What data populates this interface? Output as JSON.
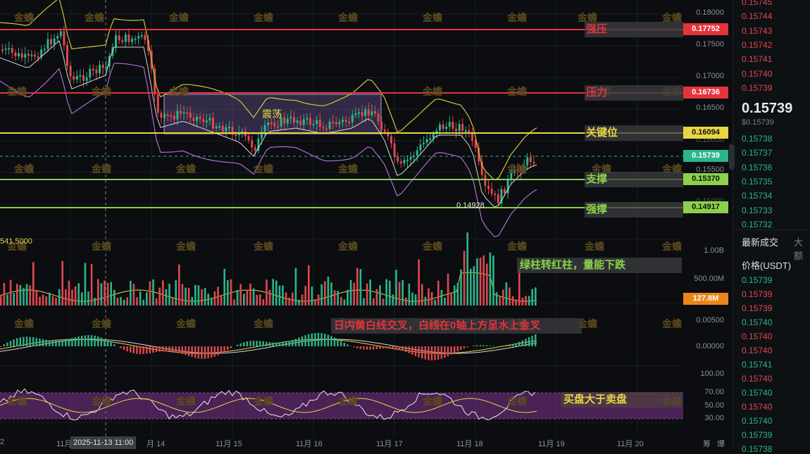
{
  "colors": {
    "up": "#2bb58a",
    "down": "#e0484f",
    "yellow": "#e8d641",
    "green": "#8bd14a",
    "red": "#e3343c",
    "purple": "#b06ad0",
    "white": "#d8d8d8"
  },
  "price_axis": [
    "0.18000",
    "0.17500",
    "0.17000",
    "0.16500",
    "0.16000",
    "0.15500",
    "0.15000"
  ],
  "price_tags": {
    "p17752": "0.17752",
    "p16736": "0.16736",
    "p16094": "0.16094",
    "p15739": "0.15739",
    "p15370": "0.15370",
    "p14917": "0.14917"
  },
  "levels": {
    "strong_resist": "强压",
    "resist": "压力",
    "key": "关键位",
    "support": "支撑",
    "strong_support": "强撑"
  },
  "range_label": "震荡",
  "low_label": "0.14928",
  "volume": {
    "left_value": "541.5000",
    "axis_1b": "1.00B",
    "axis_500m": "500.00M",
    "current": "127.8M",
    "note": "绿柱转红柱，量能下跌"
  },
  "macd": {
    "axis_top": "0.00500",
    "axis_zero": "0.00000",
    "note": "日内黄白线交叉，白线在0轴上方呈水上金叉"
  },
  "rsi": {
    "axis_100": "100.00",
    "axis_70": "70.00",
    "axis_50": "50.00",
    "axis_30": "30.00",
    "note": "买盘大于卖盘"
  },
  "time_axis": {
    "l0": "2",
    "l1": "11月",
    "crosshair": "2025-11-13 11:00",
    "l2": "月 14",
    "l3": "11月 15",
    "l4": "11月 16",
    "l5": "11月 17",
    "l6": "11月 18",
    "l7": "11月 19",
    "l8": "11月 20",
    "corner1": "筹",
    "corner2": "爆"
  },
  "watermark": "金蟾",
  "order_book": {
    "asks": [
      "0.15745",
      "0.15744",
      "0.15743",
      "0.15742",
      "0.15741",
      "0.15740",
      "0.15739"
    ],
    "last_price": "0.15739",
    "last_sub": "$0.15739",
    "bids": [
      "0.15738",
      "0.15737",
      "0.15736",
      "0.15735",
      "0.15734",
      "0.15733",
      "0.15732"
    ],
    "tab_trades": "最新成交",
    "tab_large": "大额",
    "header_price": "价格(USDT)",
    "trades": [
      {
        "p": "0.15739",
        "c": "up"
      },
      {
        "p": "0.15739",
        "c": "down"
      },
      {
        "p": "0.15739",
        "c": "down"
      },
      {
        "p": "0.15740",
        "c": "up"
      },
      {
        "p": "0.15740",
        "c": "down"
      },
      {
        "p": "0.15740",
        "c": "down"
      },
      {
        "p": "0.15741",
        "c": "up"
      },
      {
        "p": "0.15740",
        "c": "down"
      },
      {
        "p": "0.15740",
        "c": "up"
      },
      {
        "p": "0.15740",
        "c": "down"
      },
      {
        "p": "0.15740",
        "c": "up"
      },
      {
        "p": "0.15739",
        "c": "up"
      },
      {
        "p": "0.15738",
        "c": "up"
      }
    ]
  }
}
